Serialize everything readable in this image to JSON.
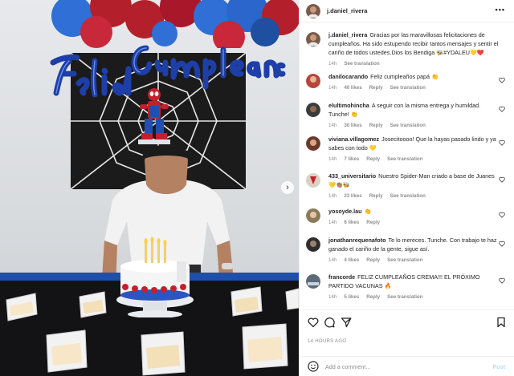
{
  "post": {
    "username": "j.daniel_rivera",
    "more_label": "•••",
    "photo_alt_next": "›"
  },
  "caption": {
    "username": "j.daniel_rivera",
    "text": "Gracias por las maravillosas felicitaciones de cumpleaños. Ha sido estupendo recibir tantos mensajes y sentir el cariño de todos ustedes.Dios los Bendiga 🐝#YDALEU💛❤️",
    "time": "14h",
    "see_translation": "See translation"
  },
  "comments": [
    {
      "username": "danilocarando",
      "text": "Feliz cumpleaños papá 👏",
      "time": "14h",
      "likes": "40 likes",
      "reply": "Reply",
      "see_translation": "See translation",
      "avatar_color": "#b8453b"
    },
    {
      "username": "elultimohincha",
      "text": "A seguir con la misma entrega y humildad. Tunche! 👏",
      "time": "14h",
      "likes": "30 likes",
      "reply": "Reply",
      "see_translation": "See translation",
      "avatar_color": "#3b3b3b"
    },
    {
      "username": "viviana.villagomez",
      "text": "Josecitoooo! Que la hayas pasado lindo y ya sabes con todo 💛",
      "time": "14h",
      "likes": "7 likes",
      "reply": "Reply",
      "see_translation": "See translation",
      "avatar_color": "#6b3a2d"
    },
    {
      "username": "433_universitario",
      "text": "Nuestro Spider-Man criado a base de Juanes 💛👏🏽🐝",
      "time": "14h",
      "likes": "23 likes",
      "reply": "Reply",
      "see_translation": "See translation",
      "avatar_color": "#d9d2c4"
    },
    {
      "username": "yosoyde.lau",
      "text": "👏",
      "time": "14h",
      "likes": "6 likes",
      "reply": "Reply",
      "see_translation": "",
      "avatar_color": "#8a7a5a"
    },
    {
      "username": "jonathanrequenafoto",
      "text": "Te lo mereces. Tunche. Con trabajo te haz ganado el cariño de la gente, sigue así.",
      "time": "14h",
      "likes": "4 likes",
      "reply": "Reply",
      "see_translation": "See translation",
      "avatar_color": "#2e2e2e"
    },
    {
      "username": "francorde",
      "text": "FELIZ CUMPLEAÑOS CREMA!!! EL PRÓXIMO PARTIDO VACUNAS 🔥",
      "time": "14h",
      "likes": "5 likes",
      "reply": "Reply",
      "see_translation": "See translation",
      "avatar_color": "#5a6a7a"
    }
  ],
  "actions": {
    "like_icon": "heart-outline-icon",
    "comment_icon": "comment-bubble-icon",
    "share_icon": "paper-plane-icon",
    "save_icon": "bookmark-icon"
  },
  "date_label": "14 HOURS AGO",
  "add_comment": {
    "placeholder": "Add a comment...",
    "post_label": "Post"
  }
}
